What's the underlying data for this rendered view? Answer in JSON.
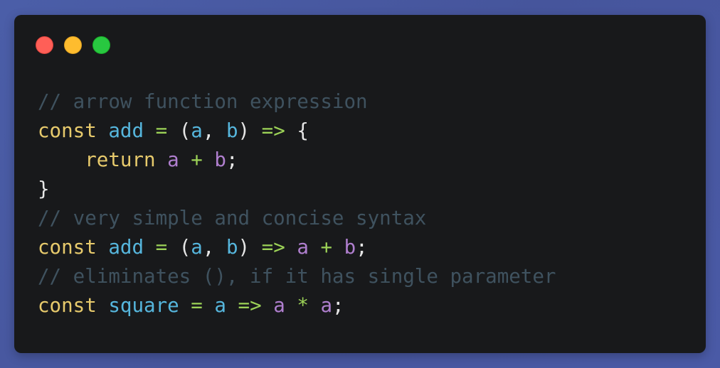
{
  "window": {
    "controls": [
      {
        "name": "close",
        "color": "#ff5f57"
      },
      {
        "name": "minimize",
        "color": "#febc2e"
      },
      {
        "name": "maximize",
        "color": "#28c840"
      }
    ]
  },
  "code": {
    "language": "javascript",
    "lines": [
      [
        {
          "t": "comment",
          "v": "// arrow function expression"
        }
      ],
      [
        {
          "t": "keyword",
          "v": "const"
        },
        {
          "t": "punct",
          "v": " "
        },
        {
          "t": "ident",
          "v": "add"
        },
        {
          "t": "punct",
          "v": " "
        },
        {
          "t": "op",
          "v": "="
        },
        {
          "t": "punct",
          "v": " ("
        },
        {
          "t": "param",
          "v": "a"
        },
        {
          "t": "punct",
          "v": ", "
        },
        {
          "t": "param",
          "v": "b"
        },
        {
          "t": "punct",
          "v": ") "
        },
        {
          "t": "op",
          "v": "=>"
        },
        {
          "t": "punct",
          "v": " {"
        }
      ],
      [
        {
          "t": "punct",
          "v": "    "
        },
        {
          "t": "keyword",
          "v": "return"
        },
        {
          "t": "punct",
          "v": " "
        },
        {
          "t": "var",
          "v": "a"
        },
        {
          "t": "punct",
          "v": " "
        },
        {
          "t": "op",
          "v": "+"
        },
        {
          "t": "punct",
          "v": " "
        },
        {
          "t": "var",
          "v": "b"
        },
        {
          "t": "punct",
          "v": ";"
        }
      ],
      [
        {
          "t": "punct",
          "v": "}"
        }
      ],
      [
        {
          "t": "comment",
          "v": "// very simple and concise syntax"
        }
      ],
      [
        {
          "t": "keyword",
          "v": "const"
        },
        {
          "t": "punct",
          "v": " "
        },
        {
          "t": "ident",
          "v": "add"
        },
        {
          "t": "punct",
          "v": " "
        },
        {
          "t": "op",
          "v": "="
        },
        {
          "t": "punct",
          "v": " ("
        },
        {
          "t": "param",
          "v": "a"
        },
        {
          "t": "punct",
          "v": ", "
        },
        {
          "t": "param",
          "v": "b"
        },
        {
          "t": "punct",
          "v": ") "
        },
        {
          "t": "op",
          "v": "=>"
        },
        {
          "t": "punct",
          "v": " "
        },
        {
          "t": "var",
          "v": "a"
        },
        {
          "t": "punct",
          "v": " "
        },
        {
          "t": "op",
          "v": "+"
        },
        {
          "t": "punct",
          "v": " "
        },
        {
          "t": "var",
          "v": "b"
        },
        {
          "t": "punct",
          "v": ";"
        }
      ],
      [
        {
          "t": "comment",
          "v": "// eliminates (), if it has single parameter"
        }
      ],
      [
        {
          "t": "keyword",
          "v": "const"
        },
        {
          "t": "punct",
          "v": " "
        },
        {
          "t": "ident",
          "v": "square"
        },
        {
          "t": "punct",
          "v": " "
        },
        {
          "t": "op",
          "v": "="
        },
        {
          "t": "punct",
          "v": " "
        },
        {
          "t": "param",
          "v": "a"
        },
        {
          "t": "punct",
          "v": " "
        },
        {
          "t": "op",
          "v": "=>"
        },
        {
          "t": "punct",
          "v": " "
        },
        {
          "t": "var",
          "v": "a"
        },
        {
          "t": "punct",
          "v": " "
        },
        {
          "t": "op",
          "v": "*"
        },
        {
          "t": "punct",
          "v": " "
        },
        {
          "t": "var",
          "v": "a"
        },
        {
          "t": "punct",
          "v": ";"
        }
      ]
    ]
  }
}
